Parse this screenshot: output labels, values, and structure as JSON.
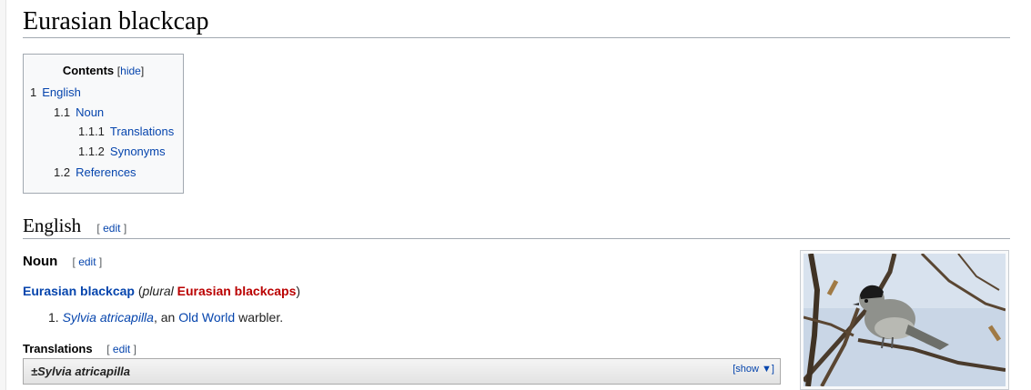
{
  "page": {
    "title": "Eurasian blackcap"
  },
  "toc": {
    "heading": "Contents",
    "hide_open": "[",
    "hide_label": "hide",
    "hide_close": "]",
    "items": [
      {
        "num": "1",
        "label": "English"
      },
      {
        "num": "1.1",
        "label": "Noun"
      },
      {
        "num": "1.1.1",
        "label": "Translations"
      },
      {
        "num": "1.1.2",
        "label": "Synonyms"
      },
      {
        "num": "1.2",
        "label": "References"
      }
    ]
  },
  "section_english": {
    "heading": "English",
    "edit_open": "[",
    "edit_label": "edit",
    "edit_close": "]"
  },
  "section_noun": {
    "heading": "Noun",
    "edit_open": "[",
    "edit_label": "edit",
    "edit_close": "]",
    "headword": "Eurasian blackcap",
    "plural_open": " (",
    "plural_word": "plural",
    "plural_form": "Eurasian blackcaps",
    "plural_close": ")",
    "definition_number": "1.",
    "definition_link": "Sylvia atricapilla",
    "definition_sep": ", an ",
    "definition_link2": "Old World",
    "definition_tail": " warbler."
  },
  "section_translations": {
    "heading": "Translations",
    "edit_open": "[",
    "edit_label": "edit",
    "edit_close": "]",
    "box_title": "±Sylvia atricapilla",
    "show_label": "[show ▼]"
  },
  "image": {
    "icon": "bird-photo",
    "colors": {
      "sky": "#c9d6e6",
      "branch": "#4a3b2c",
      "bird_body": "#8f918c",
      "bird_cap": "#1a1a1a"
    }
  }
}
